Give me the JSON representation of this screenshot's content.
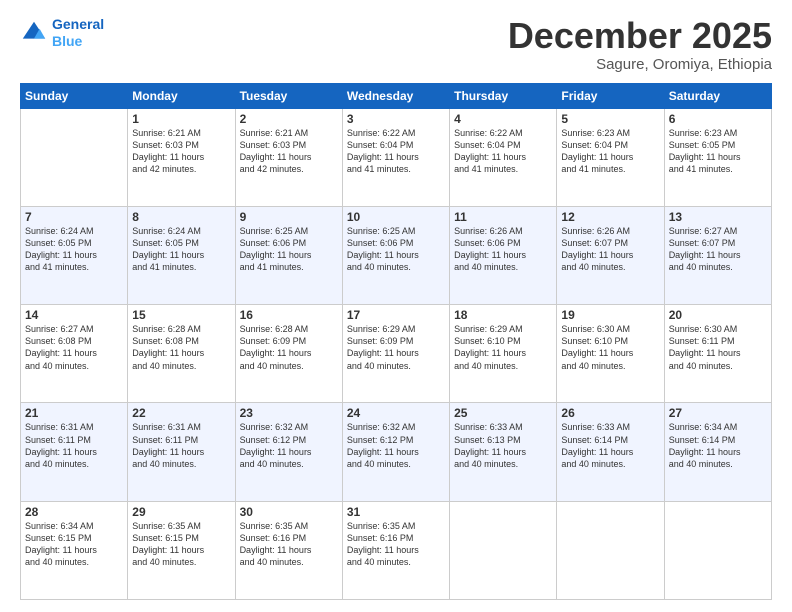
{
  "logo": {
    "line1": "General",
    "line2": "Blue"
  },
  "title": "December 2025",
  "subtitle": "Sagure, Oromiya, Ethiopia",
  "days_of_week": [
    "Sunday",
    "Monday",
    "Tuesday",
    "Wednesday",
    "Thursday",
    "Friday",
    "Saturday"
  ],
  "weeks": [
    [
      {
        "day": "",
        "info": ""
      },
      {
        "day": "1",
        "info": "Sunrise: 6:21 AM\nSunset: 6:03 PM\nDaylight: 11 hours\nand 42 minutes."
      },
      {
        "day": "2",
        "info": "Sunrise: 6:21 AM\nSunset: 6:03 PM\nDaylight: 11 hours\nand 42 minutes."
      },
      {
        "day": "3",
        "info": "Sunrise: 6:22 AM\nSunset: 6:04 PM\nDaylight: 11 hours\nand 41 minutes."
      },
      {
        "day": "4",
        "info": "Sunrise: 6:22 AM\nSunset: 6:04 PM\nDaylight: 11 hours\nand 41 minutes."
      },
      {
        "day": "5",
        "info": "Sunrise: 6:23 AM\nSunset: 6:04 PM\nDaylight: 11 hours\nand 41 minutes."
      },
      {
        "day": "6",
        "info": "Sunrise: 6:23 AM\nSunset: 6:05 PM\nDaylight: 11 hours\nand 41 minutes."
      }
    ],
    [
      {
        "day": "7",
        "info": "Sunrise: 6:24 AM\nSunset: 6:05 PM\nDaylight: 11 hours\nand 41 minutes."
      },
      {
        "day": "8",
        "info": "Sunrise: 6:24 AM\nSunset: 6:05 PM\nDaylight: 11 hours\nand 41 minutes."
      },
      {
        "day": "9",
        "info": "Sunrise: 6:25 AM\nSunset: 6:06 PM\nDaylight: 11 hours\nand 41 minutes."
      },
      {
        "day": "10",
        "info": "Sunrise: 6:25 AM\nSunset: 6:06 PM\nDaylight: 11 hours\nand 40 minutes."
      },
      {
        "day": "11",
        "info": "Sunrise: 6:26 AM\nSunset: 6:06 PM\nDaylight: 11 hours\nand 40 minutes."
      },
      {
        "day": "12",
        "info": "Sunrise: 6:26 AM\nSunset: 6:07 PM\nDaylight: 11 hours\nand 40 minutes."
      },
      {
        "day": "13",
        "info": "Sunrise: 6:27 AM\nSunset: 6:07 PM\nDaylight: 11 hours\nand 40 minutes."
      }
    ],
    [
      {
        "day": "14",
        "info": "Sunrise: 6:27 AM\nSunset: 6:08 PM\nDaylight: 11 hours\nand 40 minutes."
      },
      {
        "day": "15",
        "info": "Sunrise: 6:28 AM\nSunset: 6:08 PM\nDaylight: 11 hours\nand 40 minutes."
      },
      {
        "day": "16",
        "info": "Sunrise: 6:28 AM\nSunset: 6:09 PM\nDaylight: 11 hours\nand 40 minutes."
      },
      {
        "day": "17",
        "info": "Sunrise: 6:29 AM\nSunset: 6:09 PM\nDaylight: 11 hours\nand 40 minutes."
      },
      {
        "day": "18",
        "info": "Sunrise: 6:29 AM\nSunset: 6:10 PM\nDaylight: 11 hours\nand 40 minutes."
      },
      {
        "day": "19",
        "info": "Sunrise: 6:30 AM\nSunset: 6:10 PM\nDaylight: 11 hours\nand 40 minutes."
      },
      {
        "day": "20",
        "info": "Sunrise: 6:30 AM\nSunset: 6:11 PM\nDaylight: 11 hours\nand 40 minutes."
      }
    ],
    [
      {
        "day": "21",
        "info": "Sunrise: 6:31 AM\nSunset: 6:11 PM\nDaylight: 11 hours\nand 40 minutes."
      },
      {
        "day": "22",
        "info": "Sunrise: 6:31 AM\nSunset: 6:11 PM\nDaylight: 11 hours\nand 40 minutes."
      },
      {
        "day": "23",
        "info": "Sunrise: 6:32 AM\nSunset: 6:12 PM\nDaylight: 11 hours\nand 40 minutes."
      },
      {
        "day": "24",
        "info": "Sunrise: 6:32 AM\nSunset: 6:12 PM\nDaylight: 11 hours\nand 40 minutes."
      },
      {
        "day": "25",
        "info": "Sunrise: 6:33 AM\nSunset: 6:13 PM\nDaylight: 11 hours\nand 40 minutes."
      },
      {
        "day": "26",
        "info": "Sunrise: 6:33 AM\nSunset: 6:14 PM\nDaylight: 11 hours\nand 40 minutes."
      },
      {
        "day": "27",
        "info": "Sunrise: 6:34 AM\nSunset: 6:14 PM\nDaylight: 11 hours\nand 40 minutes."
      }
    ],
    [
      {
        "day": "28",
        "info": "Sunrise: 6:34 AM\nSunset: 6:15 PM\nDaylight: 11 hours\nand 40 minutes."
      },
      {
        "day": "29",
        "info": "Sunrise: 6:35 AM\nSunset: 6:15 PM\nDaylight: 11 hours\nand 40 minutes."
      },
      {
        "day": "30",
        "info": "Sunrise: 6:35 AM\nSunset: 6:16 PM\nDaylight: 11 hours\nand 40 minutes."
      },
      {
        "day": "31",
        "info": "Sunrise: 6:35 AM\nSunset: 6:16 PM\nDaylight: 11 hours\nand 40 minutes."
      },
      {
        "day": "",
        "info": ""
      },
      {
        "day": "",
        "info": ""
      },
      {
        "day": "",
        "info": ""
      }
    ]
  ]
}
